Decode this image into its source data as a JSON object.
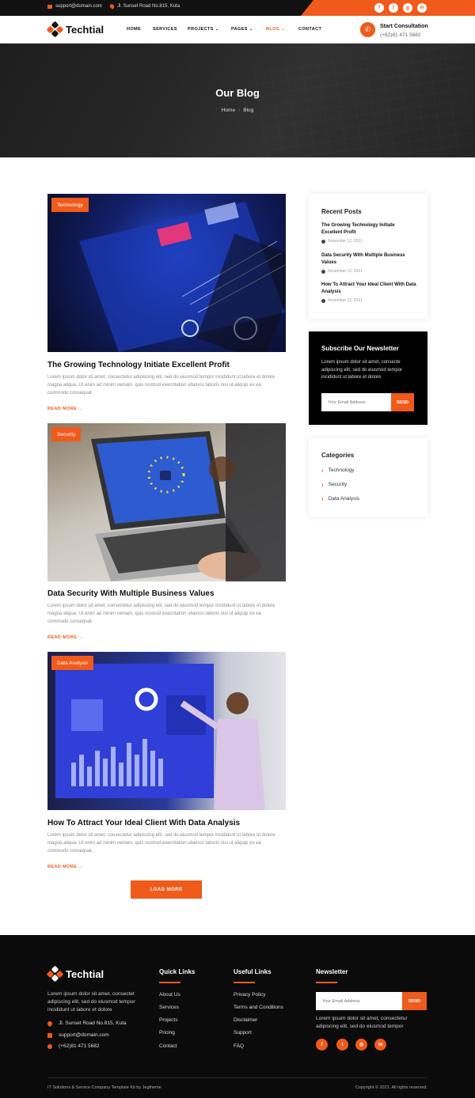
{
  "topbar": {
    "email": "support@domain.com",
    "address": "Jl. Sunset Road No.815, Kuta",
    "social": [
      "facebook-icon",
      "twitter-icon",
      "instagram-icon",
      "linkedin-icon"
    ]
  },
  "brand": {
    "name": "Techtial"
  },
  "nav": {
    "items": [
      {
        "label": "HOME",
        "dropdown": false,
        "active": false
      },
      {
        "label": "SERVICES",
        "dropdown": false,
        "active": false
      },
      {
        "label": "PROJECTS",
        "dropdown": true,
        "active": false
      },
      {
        "label": "PAGES",
        "dropdown": true,
        "active": false
      },
      {
        "label": "BLOG",
        "dropdown": true,
        "active": true
      },
      {
        "label": "CONTACT",
        "dropdown": false,
        "active": false
      }
    ],
    "cta_title": "Start Consultation",
    "cta_phone": "(+62)81 471 5682"
  },
  "hero": {
    "title": "Our Blog",
    "breadcrumb_home": "Home",
    "breadcrumb_current": "Blog"
  },
  "posts": [
    {
      "tag": "Technology",
      "title": "The Growing Technology Initiate Excellent Profit",
      "excerpt": "Lorem ipsum dolor sit amet, consectetur adipiscing elit, sed do eiusmod tempor incididunt ut labore et dolore magna aliqua. Ut enim ad minim veniam, quis nostrud exercitation ullamco laboris nisi ut aliquip ex ea commodo consequat.",
      "read_more": "READ MORE"
    },
    {
      "tag": "Security",
      "title": "Data Security With Multiple Business Values",
      "excerpt": "Lorem ipsum dolor sit amet, consectetur adipiscing elit, sed do eiusmod tempor incididunt ut labore et dolore magna aliqua. Ut enim ad minim veniam, quis nostrud exercitation ullamco laboris nisi ut aliquip ex ea commodo consequat.",
      "read_more": "READ MORE"
    },
    {
      "tag": "Data Analysis",
      "title": "How To Attract Your Ideal Client With Data Analysis",
      "excerpt": "Lorem ipsum dolor sit amet, consectetur adipiscing elit, sed do eiusmod tempor incididunt ut labore et dolore magna aliqua. Ut enim ad minim veniam, quis nostrud exercitation ullamco laboris nisi ut aliquip ex ea commodo consequat.",
      "read_more": "READ MORE"
    }
  ],
  "load_more": "LOAD MORE",
  "sidebar": {
    "recent_title": "Recent Posts",
    "recent": [
      {
        "title": "The Growing Technology Initiate Excellent Profit",
        "date": "November 12, 2021"
      },
      {
        "title": "Data Security With Multiple Business Values",
        "date": "November 12, 2021"
      },
      {
        "title": "How To Attract Your Ideal Client With Data Analysis",
        "date": "November 12, 2021"
      }
    ],
    "newsletter_title": "Subscribe Our Newsletter",
    "newsletter_text": "Lorem ipsum dolor sit amet, consecte adipiscing elit, sed do eiusmod tempor incididunt ut labore et dolore",
    "newsletter_placeholder": "Your Email Address",
    "newsletter_button": "SEND",
    "categories_title": "Categories",
    "categories": [
      "Technology",
      "Security",
      "Data Analysis"
    ]
  },
  "footer": {
    "about": "Lorem ipsum dolor sit amet, consectet adipiscing elit, sed do eiusmod tempor incididunt ut labore et dolore",
    "address": "Jl. Sunset Road No.815, Kuta",
    "email": "support@domain.com",
    "phone": "(+62)81 471 5682",
    "quick_links_title": "Quick Links",
    "quick_links": [
      "About Us",
      "Services",
      "Projects",
      "Pricing",
      "Contact"
    ],
    "useful_links_title": "Useful Links",
    "useful_links": [
      "Privacy Policy",
      "Terms and Conditions",
      "Disclaimer",
      "Support",
      "FAQ"
    ],
    "newsletter_title": "Newsletter",
    "newsletter_placeholder": "Your Email Address",
    "newsletter_button": "SEND",
    "newsletter_text": "Lorem ipsum dolor sit amet, consectetur adipiscing elit, sed do eiusmod tempor",
    "social": [
      "facebook-icon",
      "twitter-icon",
      "instagram-icon",
      "linkedin-icon"
    ],
    "copyright_left": "IT Solutions & Service Company Template Kit by Jegtheme",
    "copyright_right": "Copyright © 2021. All rights reserved."
  },
  "colors": {
    "accent": "#f05a1a",
    "dark": "#0b0b0b"
  }
}
